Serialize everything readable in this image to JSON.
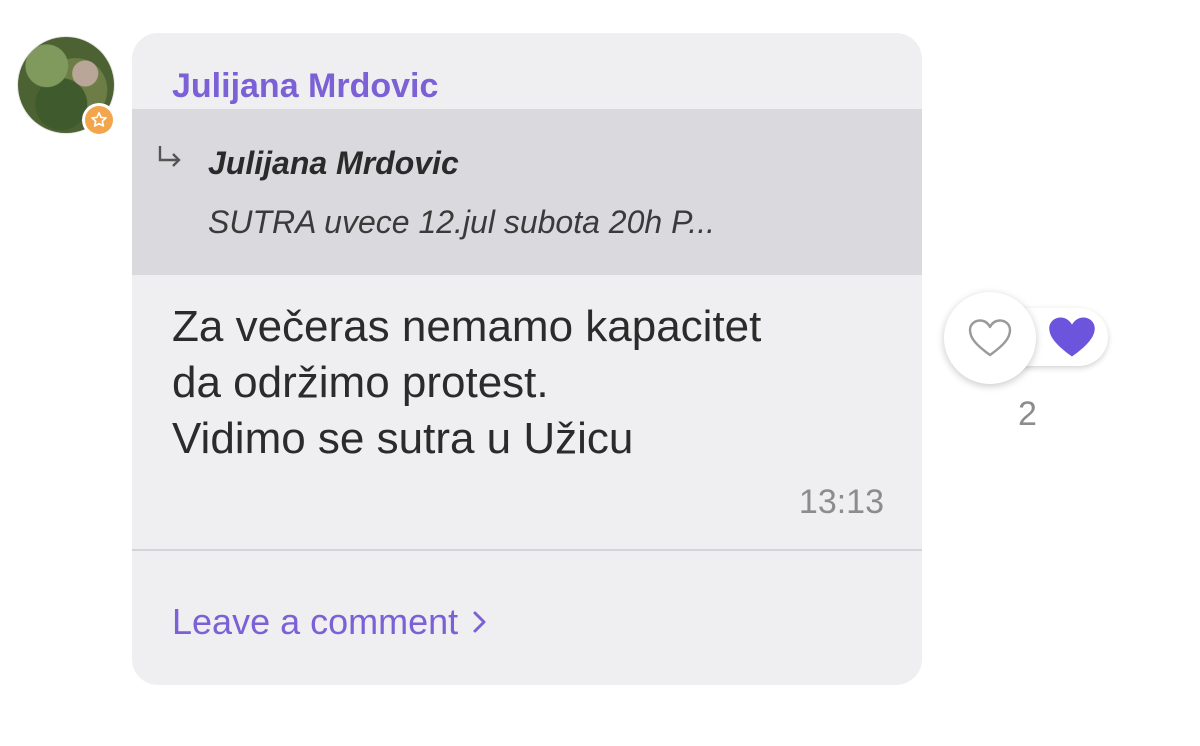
{
  "post": {
    "sender_name": "Julijana Mrdovic",
    "quoted": {
      "name": "Julijana Mrdovic",
      "text": "SUTRA uvece 12.jul subota 20h P..."
    },
    "message_lines": [
      "Za večeras nemamo kapacitet",
      "da održimo protest.",
      "Vidimo se sutra u Užicu"
    ],
    "time": "13:13",
    "comment_link": "Leave a comment"
  },
  "reactions": {
    "count": "2"
  },
  "colors": {
    "accent": "#7b60d6",
    "bubble": "#efeff1",
    "quote_bg": "#dadade",
    "badge": "#f2a54a",
    "heart_filled": "#6d54dc"
  },
  "icons": {
    "avatar_badge": "star-icon",
    "quote": "reply-arrow-icon",
    "comment": "chevron-right-icon",
    "like": "heart-outline-icon",
    "liked": "heart-filled-icon"
  }
}
